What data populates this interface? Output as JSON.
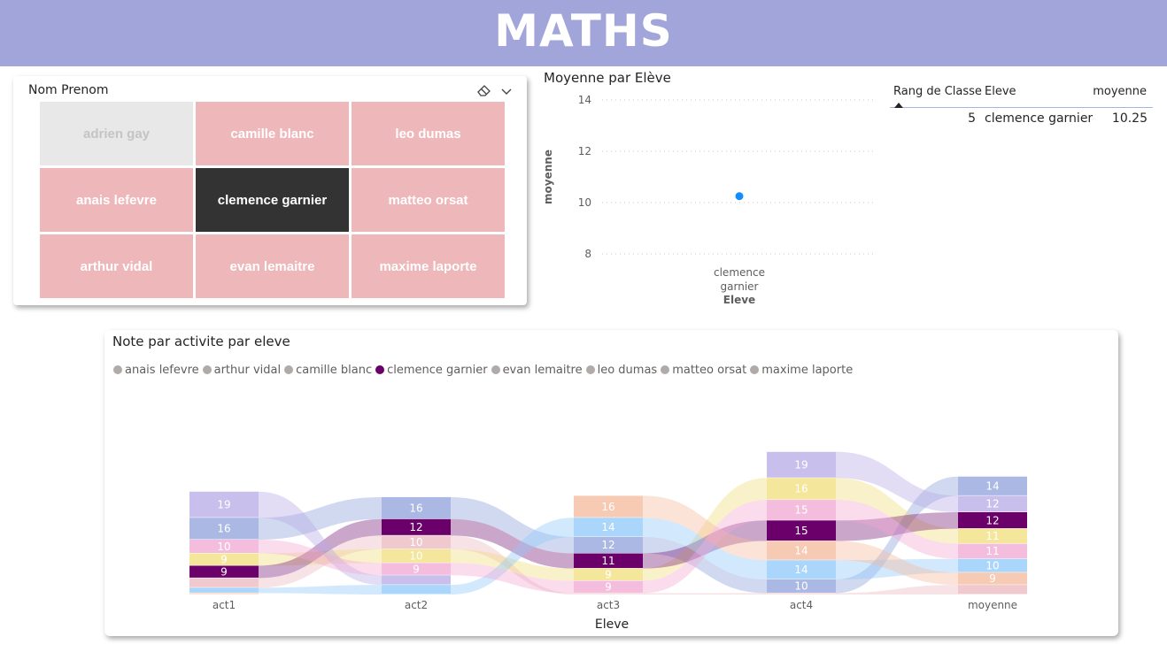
{
  "header": {
    "title": "MATHS"
  },
  "slicer": {
    "title": "Nom Prenom",
    "clear_icon": "eraser-icon",
    "dropdown_icon": "chevron-down-icon",
    "tiles": [
      {
        "label": "adrien gay",
        "state": "disabled"
      },
      {
        "label": "camille blanc",
        "state": "normal"
      },
      {
        "label": "leo dumas",
        "state": "normal"
      },
      {
        "label": "anais lefevre",
        "state": "normal"
      },
      {
        "label": "clemence garnier",
        "state": "selected"
      },
      {
        "label": "matteo orsat",
        "state": "normal"
      },
      {
        "label": "arthur vidal",
        "state": "normal"
      },
      {
        "label": "evan lemaitre",
        "state": "normal"
      },
      {
        "label": "maxime laporte",
        "state": "normal"
      }
    ]
  },
  "scatter": {
    "title": "Moyenne par Elève",
    "chart_data": {
      "type": "scatter",
      "title": "Moyenne par Elève",
      "xlabel": "Eleve",
      "ylabel": "moyenne",
      "categories": [
        "clemence garnier"
      ],
      "category_lines": [
        "clemence",
        "garnier"
      ],
      "values": [
        10.25
      ],
      "yticks": [
        8,
        10,
        12,
        14
      ],
      "ylim": [
        7.5,
        14.5
      ],
      "grid": true,
      "point_color": "#118dff"
    }
  },
  "table": {
    "headers": [
      "Rang de Classe",
      "Eleve",
      "moyenne"
    ],
    "sort_icon": "sort-up-icon",
    "rows": [
      {
        "rang": "5",
        "eleve": "clemence garnier",
        "moyenne": "10.25"
      }
    ]
  },
  "sankey": {
    "title": "Note par activite par eleve",
    "xlabel": "Eleve",
    "legend": [
      {
        "name": "anais lefevre",
        "active": false
      },
      {
        "name": "arthur vidal",
        "active": false
      },
      {
        "name": "camille blanc",
        "active": false
      },
      {
        "name": "clemence garnier",
        "active": true
      },
      {
        "name": "evan lemaitre",
        "active": false
      },
      {
        "name": "leo dumas",
        "active": false
      },
      {
        "name": "matteo orsat",
        "active": false
      },
      {
        "name": "maxime laporte",
        "active": false
      }
    ],
    "colors": {
      "anais lefevre": "#8da0d9",
      "arthur vidal": "#eab7bd",
      "camille blanc": "#f0dd7a",
      "clemence garnier": "#6b006b",
      "evan lemaitre": "#b7a9e6",
      "leo dumas": "#8fc8fa",
      "matteo orsat": "#f4b89a",
      "maxime laporte": "#f2a7d2"
    },
    "chart_data": {
      "type": "ribbon",
      "categories": [
        "act1",
        "act2",
        "act3",
        "act4",
        "moyenne"
      ],
      "columns": [
        {
          "category": "act1",
          "stack": [
            {
              "eleve": "evan lemaitre",
              "value": 19,
              "label": "19"
            },
            {
              "eleve": "anais lefevre",
              "value": 16,
              "label": "16"
            },
            {
              "eleve": "maxime laporte",
              "value": 10,
              "label": "10"
            },
            {
              "eleve": "camille blanc",
              "value": 9,
              "label": "9"
            },
            {
              "eleve": "clemence garnier",
              "value": 9,
              "label": "9"
            },
            {
              "eleve": "arthur vidal",
              "value": 7,
              "label": ""
            },
            {
              "eleve": "leo dumas",
              "value": 4,
              "label": ""
            },
            {
              "eleve": "matteo orsat",
              "value": 1,
              "label": ""
            }
          ]
        },
        {
          "category": "act2",
          "stack": [
            {
              "eleve": "anais lefevre",
              "value": 16,
              "label": "16"
            },
            {
              "eleve": "clemence garnier",
              "value": 12,
              "label": "12"
            },
            {
              "eleve": "arthur vidal",
              "value": 10,
              "label": "10"
            },
            {
              "eleve": "camille blanc",
              "value": 10,
              "label": "10"
            },
            {
              "eleve": "maxime laporte",
              "value": 9,
              "label": "9"
            },
            {
              "eleve": "evan lemaitre",
              "value": 7,
              "label": ""
            },
            {
              "eleve": "leo dumas",
              "value": 7,
              "label": ""
            }
          ]
        },
        {
          "category": "act3",
          "stack": [
            {
              "eleve": "matteo orsat",
              "value": 16,
              "label": "16"
            },
            {
              "eleve": "leo dumas",
              "value": 14,
              "label": "14"
            },
            {
              "eleve": "anais lefevre",
              "value": 12,
              "label": "12"
            },
            {
              "eleve": "clemence garnier",
              "value": 11,
              "label": "11"
            },
            {
              "eleve": "camille blanc",
              "value": 9,
              "label": "9"
            },
            {
              "eleve": "maxime laporte",
              "value": 9,
              "label": "9"
            },
            {
              "eleve": "arthur vidal",
              "value": 1,
              "label": ""
            }
          ]
        },
        {
          "category": "act4",
          "stack": [
            {
              "eleve": "evan lemaitre",
              "value": 19,
              "label": "19"
            },
            {
              "eleve": "camille blanc",
              "value": 16,
              "label": "16"
            },
            {
              "eleve": "maxime laporte",
              "value": 15,
              "label": "15"
            },
            {
              "eleve": "clemence garnier",
              "value": 15,
              "label": "15"
            },
            {
              "eleve": "matteo orsat",
              "value": 14,
              "label": "14"
            },
            {
              "eleve": "leo dumas",
              "value": 14,
              "label": "14"
            },
            {
              "eleve": "anais lefevre",
              "value": 10,
              "label": "10"
            },
            {
              "eleve": "arthur vidal",
              "value": 1,
              "label": ""
            }
          ]
        },
        {
          "category": "moyenne",
          "stack": [
            {
              "eleve": "anais lefevre",
              "value": 14,
              "label": "14"
            },
            {
              "eleve": "evan lemaitre",
              "value": 12,
              "label": "12"
            },
            {
              "eleve": "clemence garnier",
              "value": 12,
              "label": "12"
            },
            {
              "eleve": "camille blanc",
              "value": 11,
              "label": "11"
            },
            {
              "eleve": "maxime laporte",
              "value": 11,
              "label": "11"
            },
            {
              "eleve": "leo dumas",
              "value": 10,
              "label": "10"
            },
            {
              "eleve": "matteo orsat",
              "value": 9,
              "label": "9"
            },
            {
              "eleve": "arthur vidal",
              "value": 7,
              "label": ""
            }
          ]
        }
      ]
    }
  }
}
